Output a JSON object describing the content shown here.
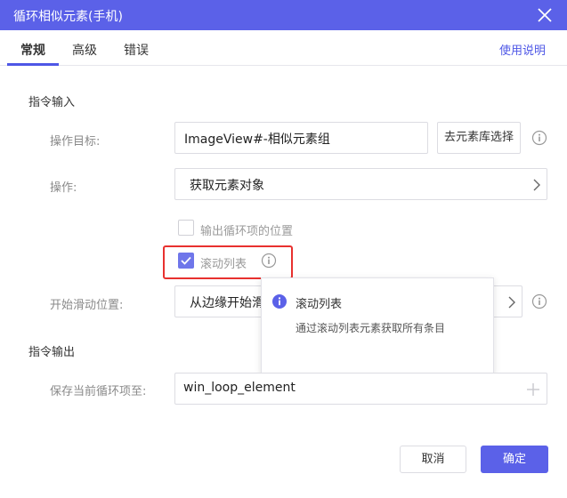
{
  "window": {
    "title": "循环相似元素(手机)"
  },
  "tabs": [
    {
      "label": "常规",
      "active": true
    },
    {
      "label": "高级",
      "active": false
    },
    {
      "label": "错误",
      "active": false
    }
  ],
  "help_link": "使用说明",
  "input_section": {
    "title": "指令输入",
    "target_label": "操作目标:",
    "target_value": "ImageView#-相似元素组",
    "library_button": "去元素库选择",
    "action_label": "操作:",
    "action_value": "获取元素对象",
    "output_position_checkbox": {
      "label": "输出循环项的位置",
      "checked": false
    },
    "scroll_list_checkbox": {
      "label": "滚动列表",
      "checked": true
    },
    "scroll_start_label": "开始滑动位置:",
    "scroll_start_value": "从边缘开始滑动"
  },
  "tooltip": {
    "title": "滚动列表",
    "body": "通过滚动列表元素获取所有条目"
  },
  "output_section": {
    "title": "指令输出",
    "save_label": "保存当前循环项至:",
    "save_value": "win_loop_element"
  },
  "footer": {
    "cancel_label": "取消",
    "ok_label": "确定"
  },
  "colors": {
    "accent": "#5b61e8",
    "highlight": "#e8312f",
    "checkbox_checked": "#6f76ea"
  }
}
